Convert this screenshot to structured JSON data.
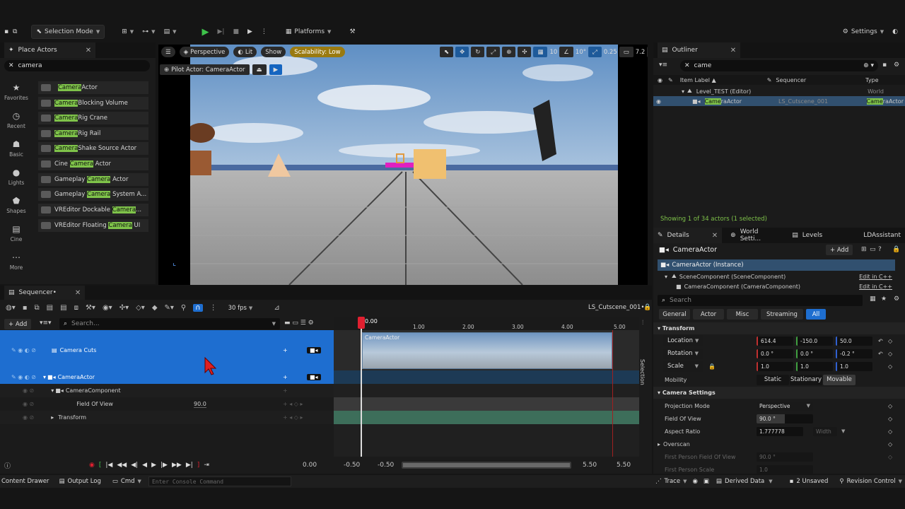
{
  "toolbar": {
    "mode_label": "Selection Mode",
    "platforms_label": "Platforms",
    "settings_label": "Settings"
  },
  "place_actors": {
    "tab_label": "Place Actors",
    "search_value": "camera",
    "categories": [
      {
        "label": "Favorites",
        "icon": "star-icon"
      },
      {
        "label": "Recent",
        "icon": "clock-icon"
      },
      {
        "label": "Basic",
        "icon": "shapes-icon"
      },
      {
        "label": "Lights",
        "icon": "bulb-icon"
      },
      {
        "label": "Shapes",
        "icon": "sphere-icon"
      },
      {
        "label": "Cine",
        "icon": "clapper-icon"
      },
      {
        "label": "More",
        "icon": "ellipsis-icon"
      }
    ],
    "items": [
      {
        "pre": "",
        "match": "Camera",
        "post": " Actor"
      },
      {
        "pre": "",
        "match": "Camera",
        "post": " Blocking Volume"
      },
      {
        "pre": "",
        "match": "Camera",
        "post": " Rig Crane"
      },
      {
        "pre": "",
        "match": "Camera",
        "post": " Rig Rail"
      },
      {
        "pre": "",
        "match": "Camera",
        "post": " Shake Source Actor"
      },
      {
        "pre": "Cine ",
        "match": "Camera",
        "post": " Actor"
      },
      {
        "pre": "Gameplay ",
        "match": "Camera",
        "post": " Actor"
      },
      {
        "pre": "Gameplay ",
        "match": "Camera",
        "post": " System A..."
      },
      {
        "pre": "VREditor Dockable ",
        "match": "Camera",
        "post": "..."
      },
      {
        "pre": "VREditor Floating ",
        "match": "Camera",
        "post": " UI"
      }
    ]
  },
  "viewport": {
    "perspective_label": "Perspective",
    "lit_label": "Lit",
    "show_label": "Show",
    "scalability_label": "Scalability: Low",
    "pilot_label": "Pilot Actor: CameraActor",
    "grid_value": "10",
    "angle_value": "10°",
    "scale_value": "0.25",
    "camera_speed": "7.2"
  },
  "outliner": {
    "tab_label": "Outliner",
    "search_value": "came",
    "col_item_label": "Item Label ▲",
    "col_sequencer": "Sequencer",
    "col_type": "Type",
    "rows": [
      {
        "label": "Level_TEST (Editor)",
        "sequencer": "",
        "type": "World"
      },
      {
        "label_match": "Came",
        "label_post": "raActor",
        "sequencer": "LS_Cutscene_001",
        "type_match": "Came",
        "type_post": "raActor"
      }
    ],
    "status": "Showing 1 of 34 actors (1 selected)"
  },
  "details": {
    "tabs": [
      "Details",
      "World Setti...",
      "Levels",
      "LDAssistant"
    ],
    "actor_name": "CameraActor",
    "add_label": "+ Add",
    "components": [
      {
        "label": "CameraActor (Instance)"
      },
      {
        "label": "SceneComponent (SceneComponent)",
        "link": "Edit in C++"
      },
      {
        "label": "CameraComponent (CameraComponent)",
        "link": "Edit in C++"
      }
    ],
    "search_placeholder": "Search",
    "filters": [
      "General",
      "Actor",
      "Misc",
      "Streaming",
      "All"
    ],
    "transform_label": "Transform",
    "location_label": "Location",
    "location": [
      "614.4",
      "-150.0",
      "50.0"
    ],
    "rotation_label": "Rotation",
    "rotation": [
      "0.0 °",
      "0.0 °",
      "-0.2 °"
    ],
    "scale_label": "Scale",
    "scale": [
      "1.0",
      "1.0",
      "1.0"
    ],
    "mobility_label": "Mobility",
    "mobility_options": [
      "Static",
      "Stationary",
      "Movable"
    ],
    "camera_settings_label": "Camera Settings",
    "projection_mode_label": "Projection Mode",
    "projection_mode_value": "Perspective",
    "fov_label": "Field Of View",
    "fov_value": "90.0 °",
    "aspect_label": "Aspect Ratio",
    "aspect_value": "1.777778",
    "aspect_width": "Width",
    "overscan_label": "Overscan",
    "fp_fov_label": "First Person Field Of View",
    "fp_fov_value": "90.0 °",
    "fp_scale_label": "First Person Scale",
    "fp_scale_value": "1.0"
  },
  "sequencer": {
    "tab_label": "Sequencer•",
    "fps_label": "30 fps",
    "sequence_name": "LS_Cutscene_001•",
    "add_label": "+ Add",
    "search_placeholder": "Search...",
    "tracks": [
      {
        "label": "Camera Cuts"
      },
      {
        "label": "CameraActor"
      },
      {
        "label": "CameraComponent"
      },
      {
        "label": "Field Of View",
        "value": "90.0"
      },
      {
        "label": "Transform"
      }
    ],
    "ruler": [
      "0.00",
      "1.00",
      "2.00",
      "3.00",
      "4.00",
      "5.00"
    ],
    "clip_label": "CameraActor",
    "current_time": "0.00",
    "range_start_a": "-0.50",
    "range_start_b": "-0.50",
    "range_end_a": "5.50",
    "range_end_b": "5.50",
    "selection_label": "Selection"
  },
  "bottombar": {
    "content_drawer": "Content Drawer",
    "output_log": "Output Log",
    "cmd": "Cmd",
    "console_placeholder": "Enter Console Command",
    "trace": "Trace",
    "derived_data": "Derived Data",
    "unsaved": "2 Unsaved",
    "revision_control": "Revision Control"
  }
}
